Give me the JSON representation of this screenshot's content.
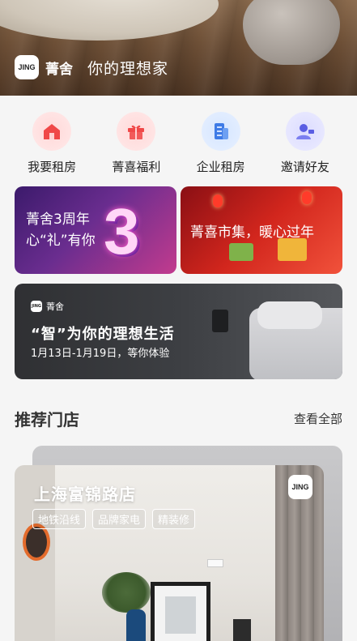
{
  "hero": {
    "logo_text": "JING",
    "brand": "菁舍",
    "slogan": "你的理想家"
  },
  "quick_actions": [
    {
      "label": "我要租房",
      "icon": "house-icon",
      "color": "#f25a5a"
    },
    {
      "label": "菁喜福利",
      "icon": "gift-icon",
      "color": "#f25a5a"
    },
    {
      "label": "企业租房",
      "icon": "building-icon",
      "color": "#4f86e8"
    },
    {
      "label": "邀请好友",
      "icon": "user-invite-icon",
      "color": "#6a6ee8"
    }
  ],
  "banners": {
    "left": {
      "line1": "菁舍3周年",
      "line2": "心“礼”有你",
      "digit": "3"
    },
    "right": {
      "text": "菁喜市集，暖心过年"
    }
  },
  "promo": {
    "logo_text": "JING",
    "brand": "菁舍",
    "title": "“智”为你的理想生活",
    "subtitle": "1月13日-1月19日，等你体验"
  },
  "section": {
    "title": "推荐门店",
    "more": "查看全部"
  },
  "store": {
    "name": "上海富锦路店",
    "logo_text": "JING",
    "tags": [
      "地铁沿线",
      "品牌家电",
      "精装修"
    ]
  }
}
